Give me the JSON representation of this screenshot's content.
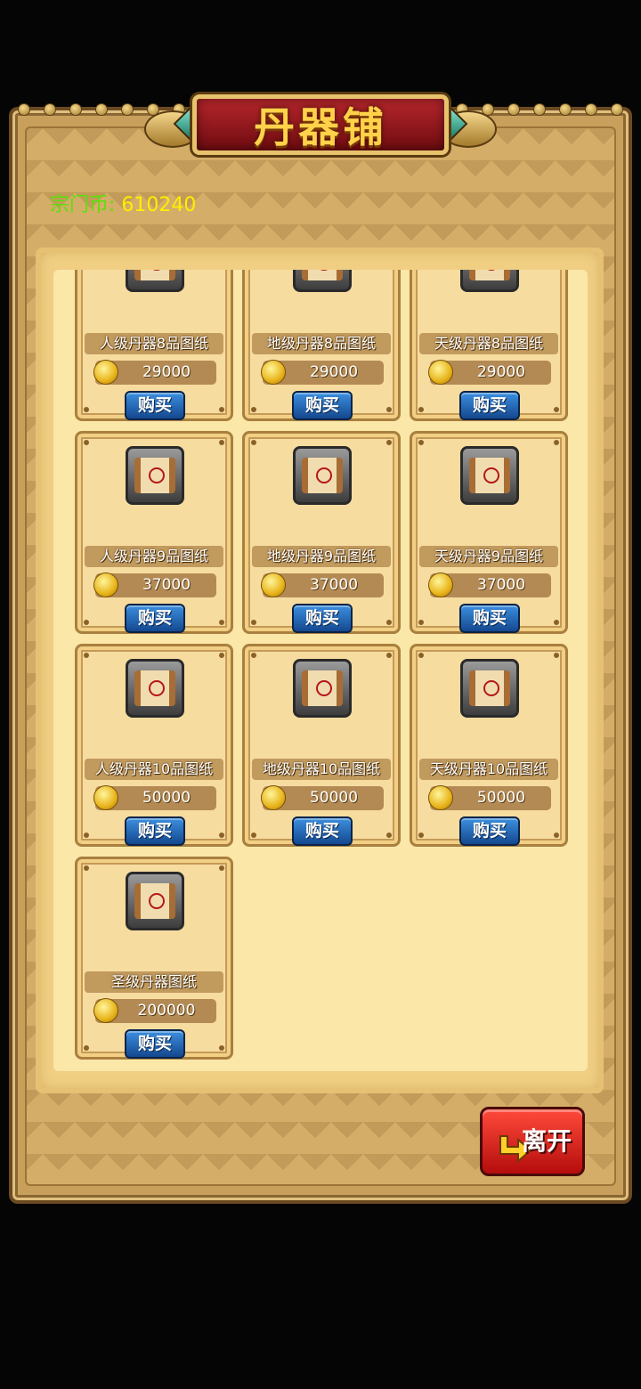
{
  "shop": {
    "title": "丹器铺",
    "currency_label": "宗门币:",
    "currency_value": "610240",
    "leave_label": "离开"
  },
  "items": [
    {
      "name": "人级丹器8品图纸",
      "price": "29000",
      "buy_label": "购买"
    },
    {
      "name": "地级丹器8品图纸",
      "price": "29000",
      "buy_label": "购买"
    },
    {
      "name": "天级丹器8品图纸",
      "price": "29000",
      "buy_label": "购买"
    },
    {
      "name": "人级丹器9品图纸",
      "price": "37000",
      "buy_label": "购买"
    },
    {
      "name": "地级丹器9品图纸",
      "price": "37000",
      "buy_label": "购买"
    },
    {
      "name": "天级丹器9品图纸",
      "price": "37000",
      "buy_label": "购买"
    },
    {
      "name": "人级丹器10品图纸",
      "price": "50000",
      "buy_label": "购买"
    },
    {
      "name": "地级丹器10品图纸",
      "price": "50000",
      "buy_label": "购买"
    },
    {
      "name": "天级丹器10品图纸",
      "price": "50000",
      "buy_label": "购买"
    },
    {
      "name": "圣级丹器图纸",
      "price": "200000",
      "buy_label": "购买"
    }
  ],
  "icons": {
    "item": "scroll-icon",
    "currency": "coin-icon",
    "leave": "arrow-icon"
  },
  "colors": {
    "currency_label": "#5ce00a",
    "currency_value": "#ffee00",
    "buy_button": "#1f5fb0",
    "leave_button": "#d8181a",
    "title_text": "#ffd24a"
  }
}
